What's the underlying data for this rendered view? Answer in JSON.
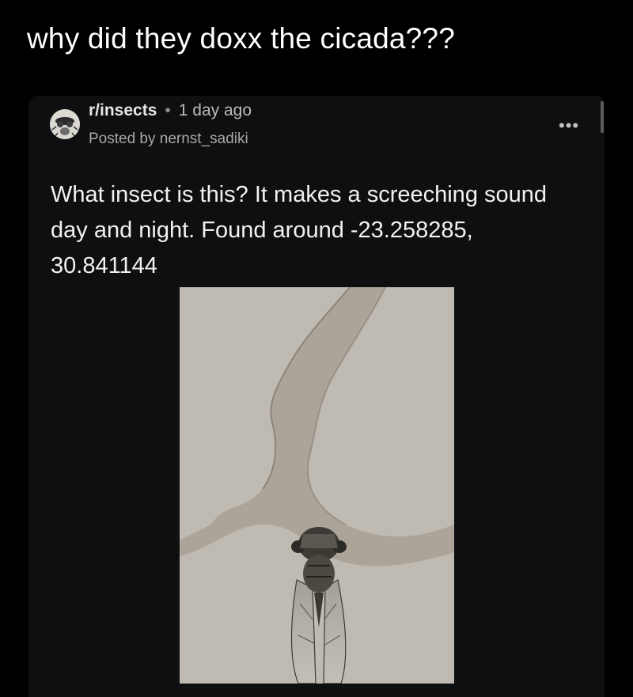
{
  "caption": "why did they doxx the cicada???",
  "post": {
    "subreddit": "r/insects",
    "separator": "•",
    "time": "1 day ago",
    "posted_by": "Posted by nernst_sadiki",
    "more_icon": "more-horizontal-icon",
    "body": "What insect is this? It makes a screeching sound day and night. Found around -23.258285, 30.841144",
    "image": "photo of a cicada on a cracked concrete surface"
  },
  "colors": {
    "background": "#000000",
    "card": "#0e0f10",
    "text": "#f2f2f2",
    "muted": "#a7a9ab"
  }
}
